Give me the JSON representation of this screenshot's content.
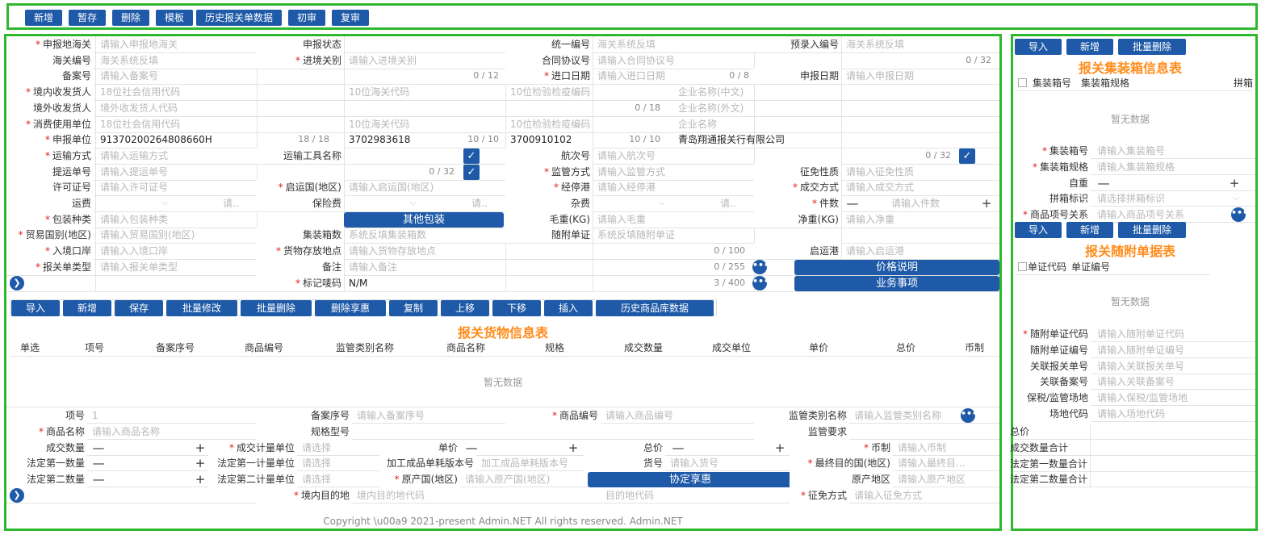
{
  "toolbar": {
    "buttons": [
      "新增",
      "暂存",
      "删除",
      "模板",
      "历史报关单数据",
      "初审",
      "复审"
    ]
  },
  "form": {
    "r1": {
      "l1": "申报地海关",
      "p1": "请输入申报地海关",
      "l2": "申报状态",
      "l3": "统一编号",
      "p3": "海关系统反填",
      "l4": "预录入编号",
      "p4": "海关系统反填"
    },
    "r2": {
      "l1": "海关编号",
      "p1": "海关系统反填",
      "l2": "进境关别",
      "p2": "请输入进境关别",
      "l3": "合同协议号",
      "p3": "请输入合同协议号",
      "c3": "0 / 32"
    },
    "r3": {
      "l1": "备案号",
      "p1": "请输入备案号",
      "c1": "0 / 12",
      "l2": "进口日期",
      "p2": "请输入进口日期",
      "c2": "0 / 8",
      "l3": "申报日期",
      "p3": "请输入申报日期"
    },
    "r4": {
      "l1": "境内收发货人",
      "p1": "18位社会信用代码",
      "p2": "10位海关代码",
      "p3": "10位检验检疫编码",
      "p4": "企业名称(中文)"
    },
    "r5": {
      "l1": "境外收发货人",
      "p1": "境外收发货人代码",
      "c1": "0 / 18",
      "p4": "企业名称(外文)"
    },
    "r6": {
      "l1": "消费使用单位",
      "p1": "18位社会信用代码",
      "p2": "10位海关代码",
      "p3": "10位检验检疫编码",
      "p4": "企业名称"
    },
    "r7": {
      "l1": "申报单位",
      "v1": "91370200264808660H",
      "c1": "18 / 18",
      "v2": "3702983618",
      "c2": "10 / 10",
      "v3": "3700910102",
      "c3": "10 / 10",
      "v4": "青岛翔通报关行有限公司"
    },
    "r8": {
      "l1": "运输方式",
      "p1": "请输入运输方式",
      "l2": "运输工具名称",
      "l3": "航次号",
      "p3": "请输入航次号",
      "c3": "0 / 32"
    },
    "r9": {
      "l1": "提运单号",
      "p1": "请输入提运单号",
      "c1": "0 / 32",
      "l2": "监管方式",
      "p2": "请输入监管方式",
      "l3": "征免性质",
      "p3": "请输入征免性质"
    },
    "r10": {
      "l1": "许可证号",
      "p1": "请输入许可证号",
      "l2": "启运国(地区)",
      "p2": "请输入启运国(地区)",
      "l3": "经停港",
      "p3": "请输入经停港",
      "l4": "成交方式",
      "p4": "请输入成交方式"
    },
    "r11": {
      "l1": "运费",
      "p1": "请..",
      "l2": "保险费",
      "p2": "请..",
      "l3": "杂费",
      "p3": "请..",
      "l4": "件数",
      "p4": "请输入件数"
    },
    "r12": {
      "l1": "包装种类",
      "p1": "请输入包装种类",
      "btn": "其他包装",
      "l3": "毛重(KG)",
      "p3": "请输入毛重",
      "l4": "净重(KG)",
      "p4": "请输入净重"
    },
    "r13": {
      "l1": "贸易国别(地区)",
      "p1": "请输入贸易国别(地区)",
      "l2": "集装箱数",
      "p2": "系统反填集装箱数",
      "l3": "随附单证",
      "p3": "系统反填随附单证"
    },
    "r14": {
      "l1": "入境口岸",
      "p1": "请输入入境口岸",
      "l2": "货物存放地点",
      "p2": "请输入货物存放地点",
      "c2": "0 / 100",
      "l4": "启运港",
      "p4": "请输入启运港"
    },
    "r15": {
      "l1": "报关单类型",
      "p1": "请输入报关单类型",
      "l2": "备注",
      "p2": "请输入备注",
      "c2": "0 / 255",
      "btn": "价格说明"
    },
    "r16": {
      "l2": "标记唛码",
      "v2": "N/M",
      "c2": "3 / 400",
      "btn": "业务事项"
    }
  },
  "goods": {
    "buttons": [
      "导入",
      "新增",
      "保存",
      "批量修改",
      "批量删除",
      "删除享惠",
      "复制",
      "上移",
      "下移",
      "插入",
      "历史商品库数据"
    ],
    "title": "报关货物信息表",
    "columns": [
      "单选",
      "项号",
      "备案序号",
      "商品编号",
      "监管类别名称",
      "商品名称",
      "规格",
      "成交数量",
      "成交单位",
      "单价",
      "总价",
      "币制"
    ],
    "empty": "暂无数据"
  },
  "detail": {
    "d1": {
      "l1": "项号",
      "v1": "1",
      "l2": "备案序号",
      "p2": "请输入备案序号",
      "l3": "商品编号",
      "p3": "请输入商品编号",
      "l4": "监管类别名称",
      "p4": "请输入监管类别名称"
    },
    "d2": {
      "l1": "商品名称",
      "p1": "请输入商品名称",
      "l2": "规格型号",
      "l4": "监管要求"
    },
    "d3": {
      "l1": "成交数量",
      "l2": "成交计量单位",
      "p2": "请选择",
      "l3": "单价",
      "l4": "总价",
      "l5": "币制",
      "p5": "请输入币制"
    },
    "d4": {
      "l1": "法定第一数量",
      "l2": "法定第一计量单位",
      "p2": "请选择",
      "l3": "加工成品单耗版本号",
      "p3": "加工成品单耗版本号",
      "l4": "货号",
      "p4": "请输入货号",
      "l5": "最终目的国(地区)",
      "p5": "请输入最终目..."
    },
    "d5": {
      "l1": "法定第二数量",
      "l2": "法定第二计量单位",
      "p2": "请选择",
      "l3": "原产国(地区)",
      "p3": "请输入原产国(地区)",
      "btn": "协定享惠",
      "l5": "原产地区",
      "p5": "请输入原产地区"
    },
    "d6": {
      "l2": "境内目的地",
      "p2": "境内目的地代码",
      "p3": "目的地代码",
      "l5": "征免方式",
      "p5": "请输入征免方式"
    }
  },
  "footer": "Copyright \\u00a9 2021-present Admin.NET All rights reserved. Admin.NET",
  "container": {
    "buttons": [
      "导入",
      "新增",
      "批量删除"
    ],
    "title": "报关集装箱信息表",
    "columns": [
      "集装箱号",
      "集装箱规格",
      "拼箱"
    ],
    "empty": "暂无数据",
    "f1": {
      "l": "集装箱号",
      "p": "请输入集装箱号"
    },
    "f2": {
      "l": "集装箱规格",
      "p": "请输入集装箱规格"
    },
    "f3": {
      "l": "自重"
    },
    "f4": {
      "l": "拼箱标识",
      "p": "请选择拼箱标识"
    },
    "f5": {
      "l": "商品项号关系",
      "p": "请输入商品项号关系"
    }
  },
  "docs": {
    "buttons": [
      "导入",
      "新增",
      "批量删除"
    ],
    "title": "报关随附单据表",
    "columns": [
      "单证代码",
      "单证编号"
    ],
    "empty": "暂无数据",
    "f1": {
      "l": "随附单证代码",
      "p": "请输入随附单证代码"
    },
    "f2": {
      "l": "随附单证编号",
      "p": "请输入随附单证编号"
    },
    "f3": {
      "l": "关联报关单号",
      "p": "请输入关联报关单号"
    },
    "f4": {
      "l": "关联备案号",
      "p": "请输入关联备案号"
    },
    "f5": {
      "l": "保税/监管场地",
      "p": "请输入保税/监管场地"
    },
    "f6": {
      "l": "场地代码",
      "p": "请输入场地代码"
    }
  },
  "totals": [
    "总价",
    "成交数量合计",
    "法定第一数量合计",
    "法定第二数量合计"
  ]
}
